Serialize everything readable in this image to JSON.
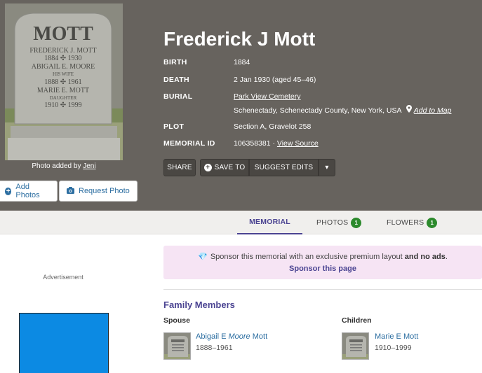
{
  "memorial": {
    "name": "Frederick J Mott",
    "birth_label": "BIRTH",
    "birth_value": "1884",
    "death_label": "DEATH",
    "death_value": "2 Jan 1930 (aged 45–46)",
    "burial_label": "BURIAL",
    "burial_cemetery": "Park View Cemetery",
    "burial_location": "Schenectady, Schenectady County, New York, USA",
    "add_to_map": "Add to Map",
    "plot_label": "PLOT",
    "plot_value": "Section A, Gravelot 258",
    "id_label": "MEMORIAL ID",
    "id_value": "106358381",
    "id_sep": "·",
    "view_source": "View Source"
  },
  "photo": {
    "credit_prefix": "Photo added by",
    "credit_user": "Jeni",
    "stone_text": [
      "MOTT",
      "FREDERICK J. MOTT",
      "1884 ✣ 1930",
      "ABIGAIL E. MOORE",
      "HIS WIFE",
      "1888 ✣ 1961",
      "MARIE E. MOTT",
      "DAUGHTER",
      "1910 ✣ 1999"
    ]
  },
  "photo_buttons": {
    "add_photos": "Add Photos",
    "request_photo": "Request Photo"
  },
  "actions": {
    "share": "SHARE",
    "save_to": "SAVE TO",
    "suggest_edits": "SUGGEST EDITS",
    "caret": "▾"
  },
  "tabs": {
    "memorial": "MEMORIAL",
    "photos": "PHOTOS",
    "photos_count": "1",
    "flowers": "FLOWERS",
    "flowers_count": "1"
  },
  "ad": {
    "label": "Advertisement"
  },
  "sponsor": {
    "text_pre": "Sponsor this memorial with an exclusive premium layout",
    "text_bold": "and no ads",
    "text_end": ".",
    "link": "Sponsor this page"
  },
  "family": {
    "title": "Family Members",
    "spouse_label": "Spouse",
    "spouse_first": "Abigail E",
    "spouse_maiden": "Moore",
    "spouse_last": "Mott",
    "spouse_dates": "1888–1961",
    "children_label": "Children",
    "child_name": "Marie E Mott",
    "child_dates": "1910–1999"
  },
  "colors": {
    "hero_bg": "#67635e",
    "accent_purple": "#4b4492",
    "link_blue": "#2c6ea1",
    "badge_green": "#2c8a2c",
    "sponsor_bg": "#f6e4f4",
    "ad_blue": "#0c8ae3"
  }
}
